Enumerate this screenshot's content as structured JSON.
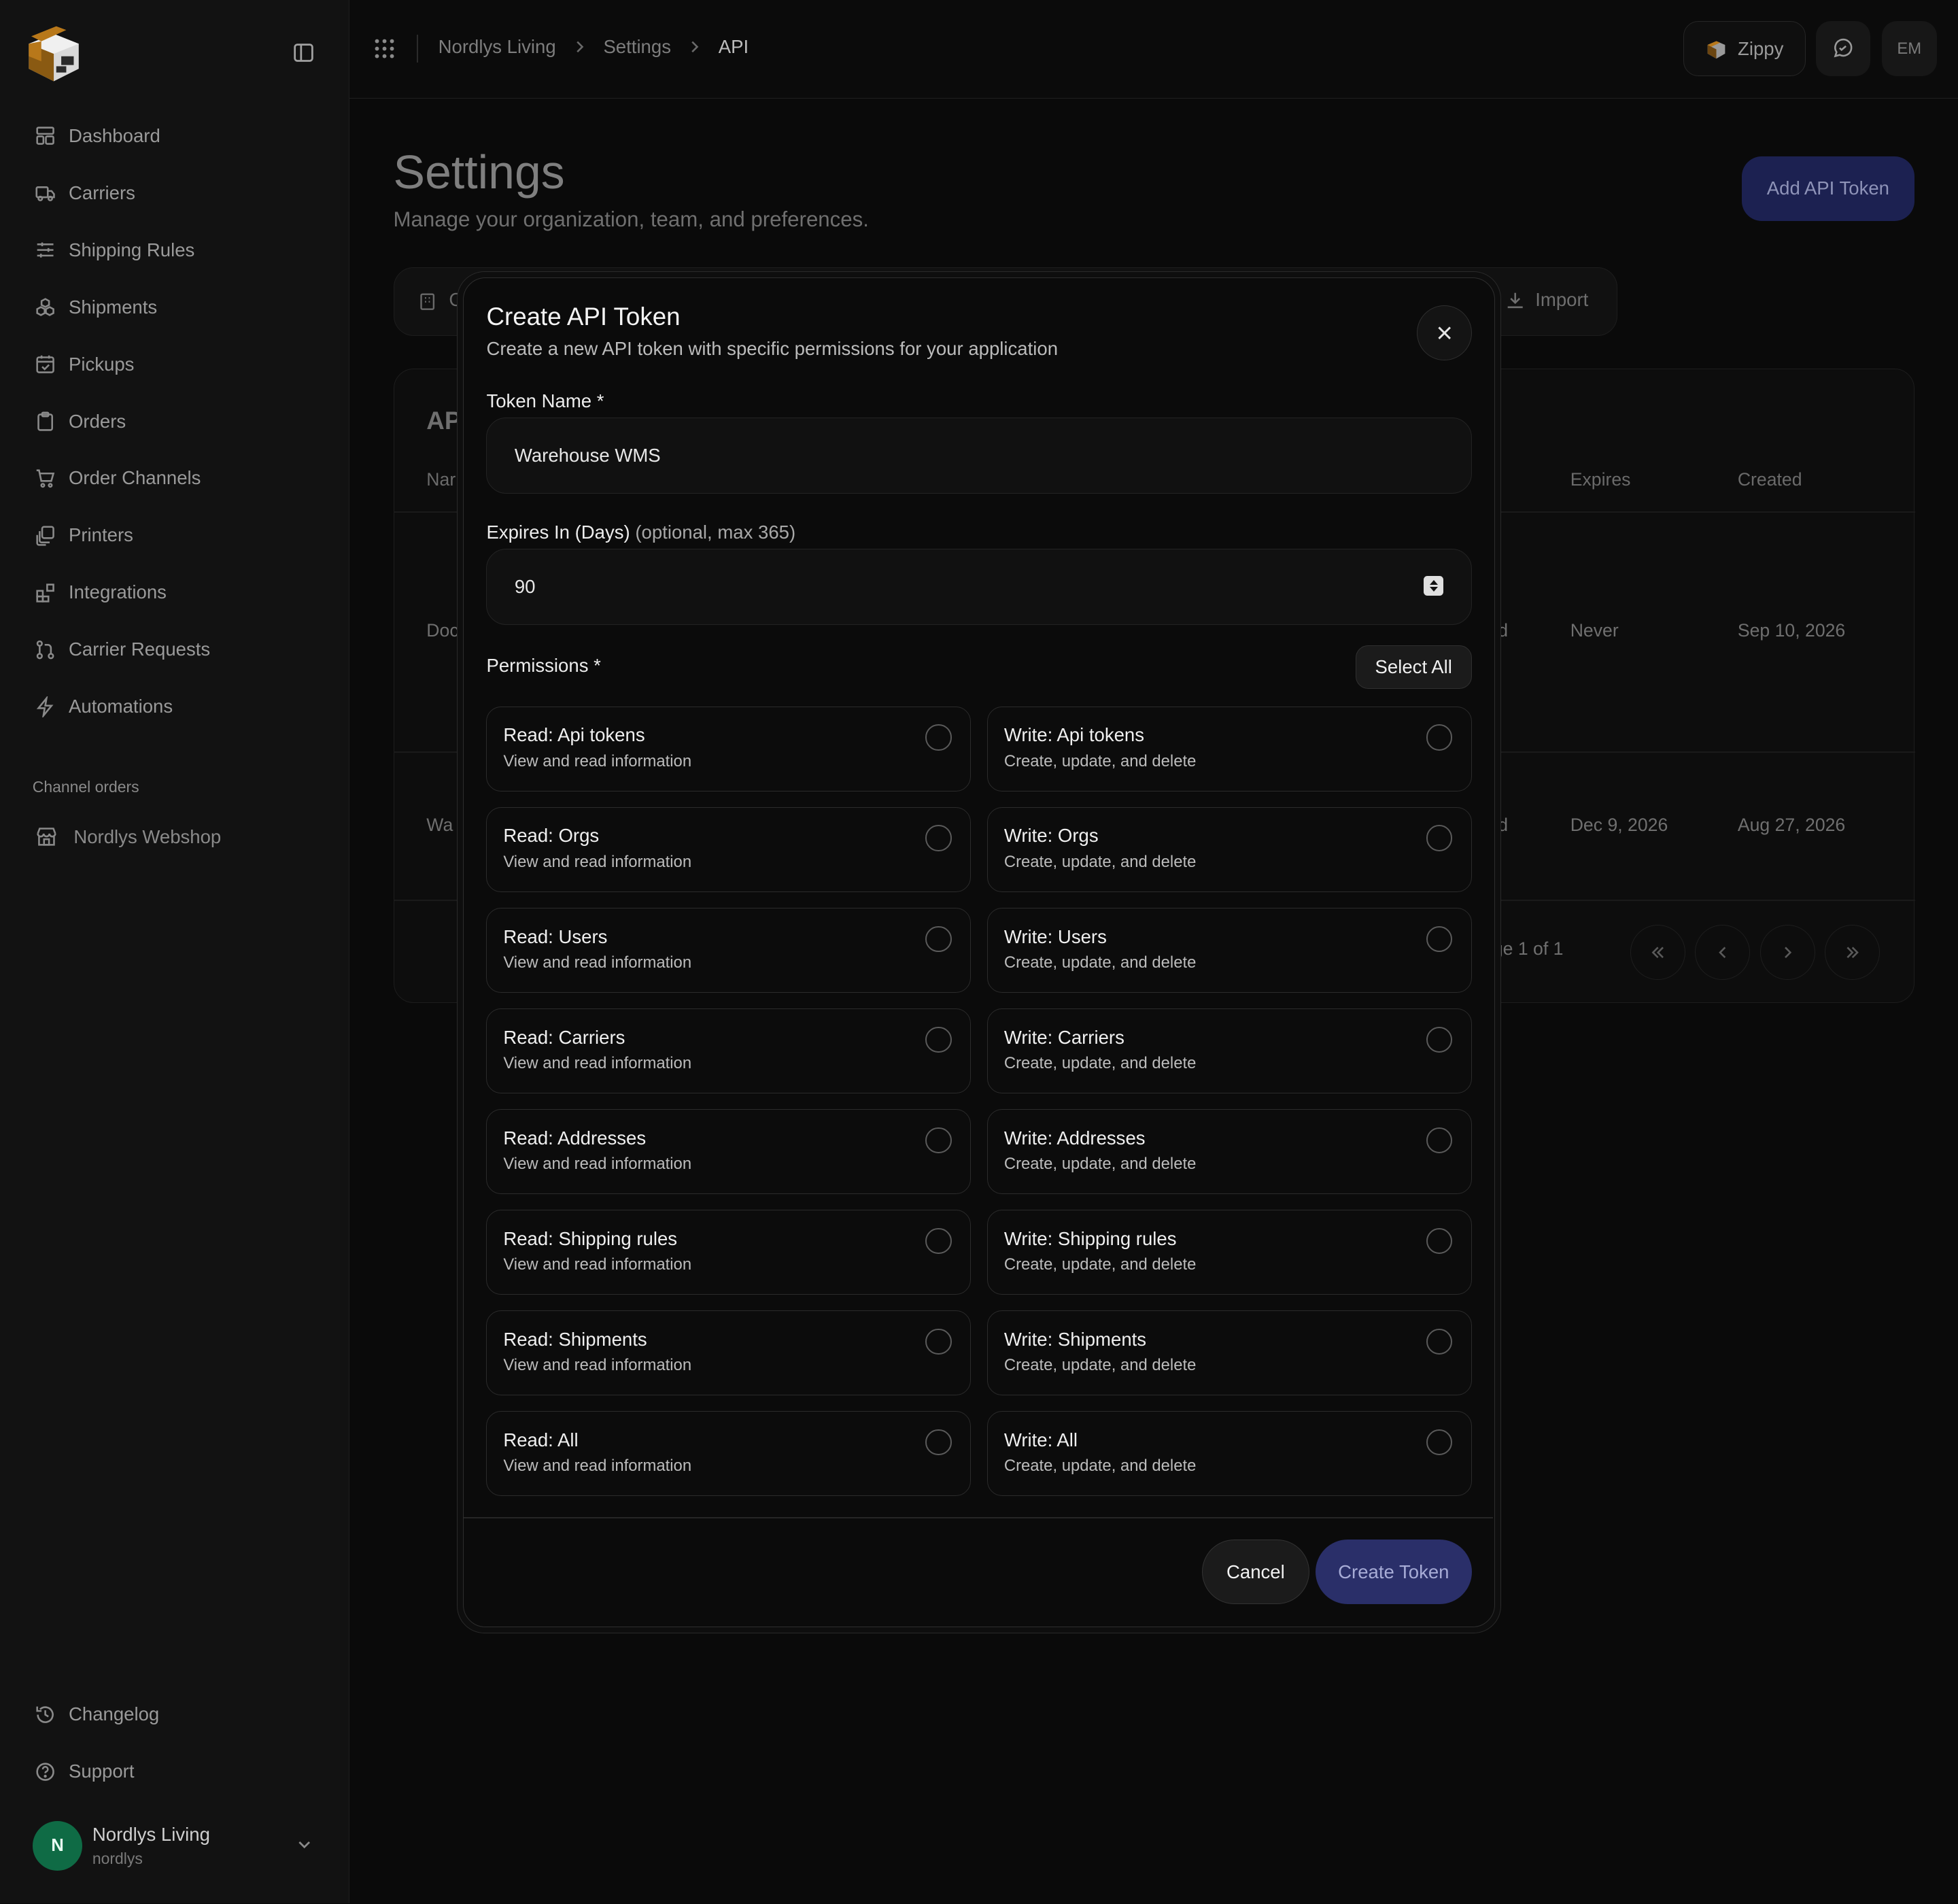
{
  "sidebar": {
    "items": [
      {
        "label": "Dashboard",
        "icon": "dashboard-icon"
      },
      {
        "label": "Carriers",
        "icon": "truck-icon"
      },
      {
        "label": "Shipping Rules",
        "icon": "sliders-icon"
      },
      {
        "label": "Shipments",
        "icon": "boxes-icon"
      },
      {
        "label": "Pickups",
        "icon": "calendar-check-icon"
      },
      {
        "label": "Orders",
        "icon": "clipboard-icon"
      },
      {
        "label": "Order Channels",
        "icon": "cart-icon"
      },
      {
        "label": "Printers",
        "icon": "printer-icon"
      },
      {
        "label": "Integrations",
        "icon": "blocks-icon"
      },
      {
        "label": "Carrier Requests",
        "icon": "git-pull-icon"
      },
      {
        "label": "Automations",
        "icon": "zap-icon"
      }
    ],
    "section_label": "Channel orders",
    "channel_item": "Nordlys Webshop",
    "bottom_items": [
      {
        "label": "Changelog",
        "icon": "history-icon"
      },
      {
        "label": "Support",
        "icon": "help-circle-icon"
      }
    ],
    "org": {
      "initial": "N",
      "name": "Nordlys Living",
      "slug": "nordlys",
      "color": "#0f6b45"
    }
  },
  "topbar": {
    "breadcrumb": [
      "Nordlys Living",
      "Settings",
      "API"
    ],
    "zippy_label": "Zippy",
    "avatar_initials": "EM"
  },
  "page": {
    "title": "Settings",
    "subtitle": "Manage your organization, team, and preferences.",
    "add_button": "Add API Token",
    "tab_partial": "C",
    "import_label": "Import",
    "table": {
      "title_partial": "AP",
      "headers": {
        "name_partial": "Nar",
        "expires": "Expires",
        "created": "Created"
      },
      "rows": [
        {
          "name_partial": "Doc",
          "status_partial": "d",
          "expires": "Never",
          "created": "Sep 10, 2026"
        },
        {
          "name_partial": "Wa",
          "status_partial": "d",
          "expires": "Dec 9, 2026",
          "created": "Aug 27, 2026"
        }
      ],
      "page_info_partial": "ge 1 of 1"
    }
  },
  "modal": {
    "title": "Create API Token",
    "subtitle": "Create a new API token with specific permissions for your application",
    "token_name_label": "Token Name *",
    "token_name_value": "Warehouse WMS",
    "expires_label": "Expires In (Days)",
    "expires_hint": "(optional, max 365)",
    "expires_value": "90",
    "permissions_label": "Permissions *",
    "select_all": "Select All",
    "permissions": [
      {
        "read": "Read: Api tokens",
        "write": "Write: Api tokens"
      },
      {
        "read": "Read: Orgs",
        "write": "Write: Orgs"
      },
      {
        "read": "Read: Users",
        "write": "Write: Users"
      },
      {
        "read": "Read: Carriers",
        "write": "Write: Carriers"
      },
      {
        "read": "Read: Addresses",
        "write": "Write: Addresses"
      },
      {
        "read": "Read: Shipping rules",
        "write": "Write: Shipping rules"
      },
      {
        "read": "Read: Shipments",
        "write": "Write: Shipments"
      },
      {
        "read": "Read: All",
        "write": "Write: All"
      }
    ],
    "read_desc": "View and read information",
    "write_desc": "Create, update, and delete",
    "cancel": "Cancel",
    "create": "Create Token"
  },
  "colors": {
    "accent": "#2a2f69",
    "background": "#0a0a0a"
  }
}
